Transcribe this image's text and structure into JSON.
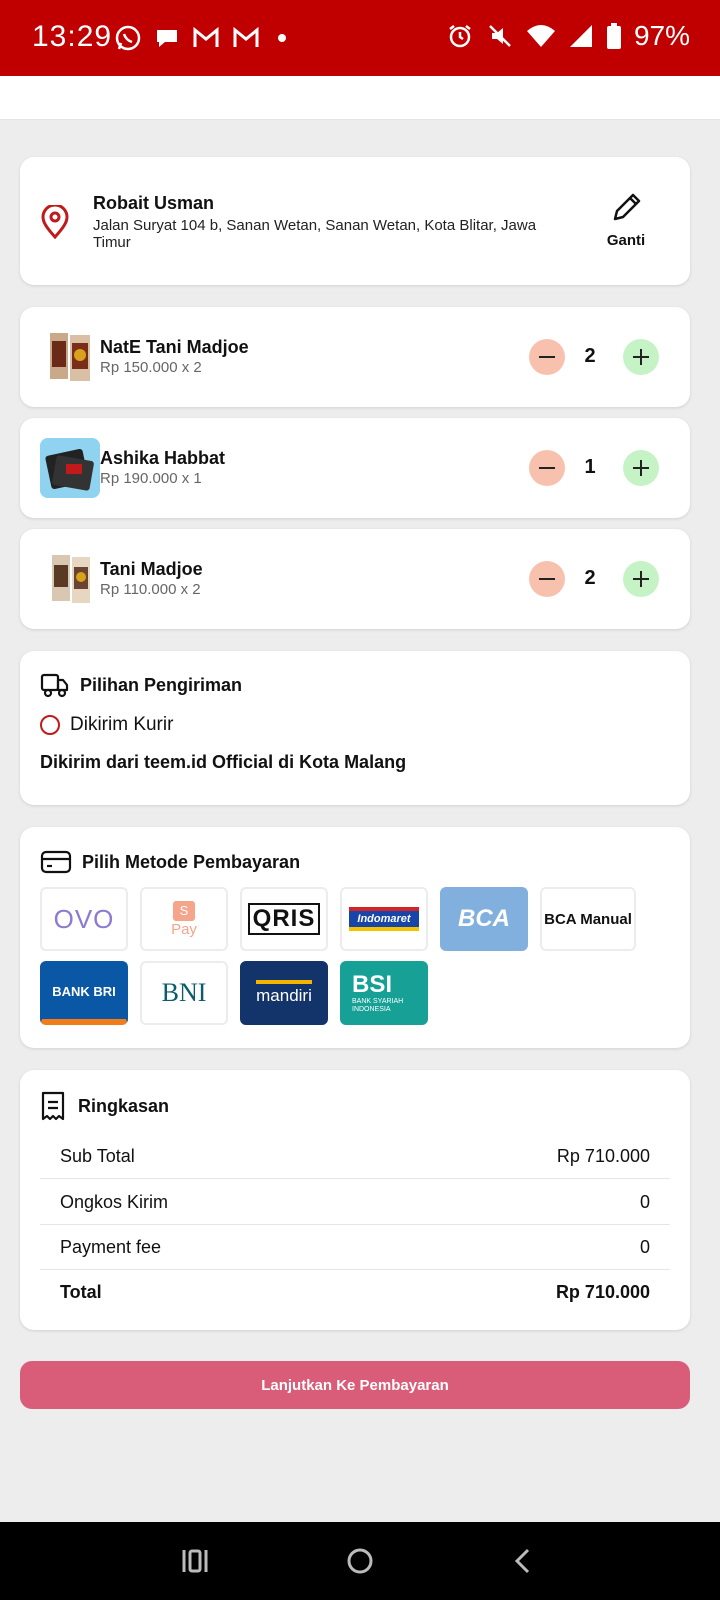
{
  "status_bar": {
    "time": "13:29",
    "battery": "97%",
    "left_icons": [
      "whatsapp-icon",
      "chat-icon",
      "gmail-icon",
      "gmail-icon",
      "dot-icon"
    ],
    "right_icons": [
      "alarm-icon",
      "mute-icon",
      "wifi-icon",
      "signal-icon",
      "battery-icon"
    ]
  },
  "address": {
    "name": "Robait Usman",
    "detail": "Jalan Suryat 104 b, Sanan Wetan, Sanan Wetan, Kota Blitar, Jawa Timur",
    "change_label": "Ganti"
  },
  "cart": {
    "items": [
      {
        "name": "NatE Tani Madjoe",
        "price": "Rp 150.000 x 2",
        "qty": "2"
      },
      {
        "name": "Ashika Habbat",
        "price": "Rp 190.000 x 1",
        "qty": "1"
      },
      {
        "name": "Tani Madjoe",
        "price": "Rp 110.000 x 2",
        "qty": "2"
      }
    ]
  },
  "shipping": {
    "title": "Pilihan Pengiriman",
    "option": "Dikirim Kurir",
    "origin": "Dikirim dari teem.id Official di Kota Malang"
  },
  "payment": {
    "title": "Pilih Metode Pembayaran",
    "methods": [
      "OVO",
      "S",
      "Pay",
      "QRIS",
      "Indomaret",
      "BCA",
      "BCA Manual",
      "BANK BRI",
      "BNI",
      "mandiri",
      "BSI",
      "BANK SYARIAH INDONESIA"
    ]
  },
  "summary": {
    "title": "Ringkasan",
    "rows": [
      {
        "label": "Sub Total",
        "value": "Rp 710.000"
      },
      {
        "label": "Ongkos Kirim",
        "value": "0"
      },
      {
        "label": "Payment fee",
        "value": "0"
      },
      {
        "label": "Total",
        "value": "Rp 710.000"
      }
    ]
  },
  "cta": {
    "label": "Lanjutkan Ke Pembayaran"
  },
  "colors": {
    "status_bar": "#c00000",
    "cta": "#d95d78",
    "minus_bg": "#f8c1ae",
    "plus_bg": "#c6f3c6",
    "accent_red": "#c21a1a"
  }
}
